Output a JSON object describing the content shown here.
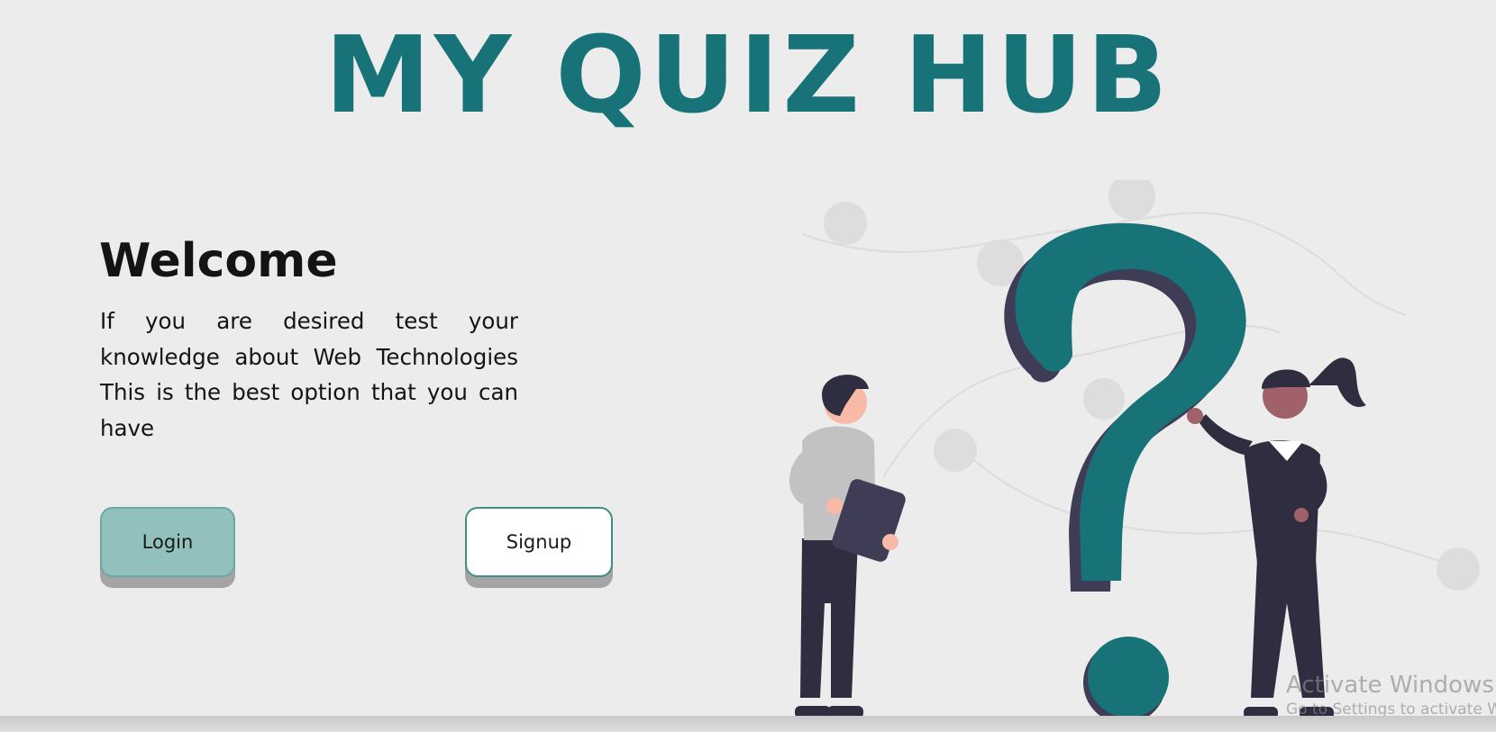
{
  "header": {
    "title": "MY QUIZ HUB"
  },
  "hero": {
    "heading": "Welcome",
    "description": "If you are desired test your knowledge about Web Technologies This is the best option that you can have",
    "login_label": "Login",
    "signup_label": "Signup"
  },
  "illustration": {
    "icon": "question-mark-people-illustration"
  },
  "watermark": {
    "title": "Activate Windows",
    "subtitle": "Go to Settings to activate Windows."
  },
  "colors": {
    "accent": "#177378",
    "login_button": "#92c1bd",
    "signup_button": "#ffffff",
    "background": "#ececec",
    "figure_dark": "#3f3d56",
    "figure_shirt": "#c2c2c2"
  }
}
